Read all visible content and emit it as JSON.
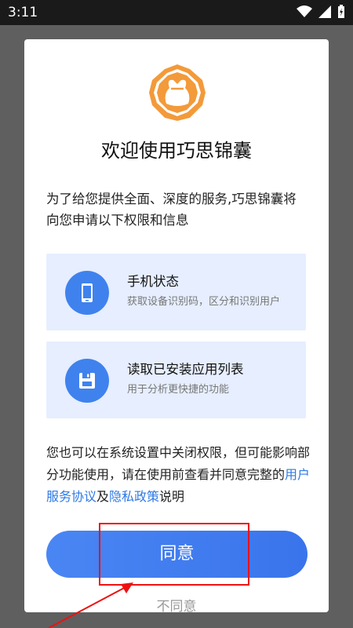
{
  "statusbar": {
    "time": "3:11",
    "icons": [
      "wifi-icon",
      "signal-icon",
      "battery-charging-icon"
    ]
  },
  "dialog": {
    "title": "欢迎使用巧思锦囊",
    "intro": "为了给您提供全面、深度的服务,巧思锦囊将向您申请以下权限和信息",
    "permissions": [
      {
        "title": "手机状态",
        "desc": "获取设备识别码，区分和识别用户",
        "icon": "phone-icon"
      },
      {
        "title": "读取已安装应用列表",
        "desc": "用于分析更快捷的功能",
        "icon": "save-icon"
      }
    ],
    "note": {
      "prefix": "您也可以在系统设置中关闭权限，但可能影响部分功能使用，请在使用前查看并同意完整的",
      "link1": "用户服务协议",
      "mid": "及",
      "link2": "隐私政策",
      "suffix": "说明"
    },
    "agree_label": "同意",
    "disagree_label": "不同意"
  },
  "colors": {
    "accent": "#3f82ee",
    "logo_orange": "#f39a3a",
    "card_bg": "#e6eeff",
    "link": "#2f79e6"
  }
}
